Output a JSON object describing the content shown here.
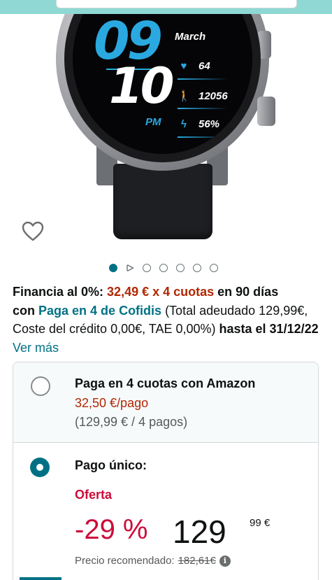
{
  "watch_face": {
    "month": "March",
    "hour": "09",
    "minute": "10",
    "ampm": "PM",
    "heart_rate": "64",
    "steps": "12056",
    "battery": "56%",
    "icons": [
      "heart-icon",
      "walker-icon",
      "bolt-icon"
    ]
  },
  "gallery": {
    "total_dots": 7,
    "active_index": 0
  },
  "finance": {
    "prefix": "Financia al 0%: ",
    "installments": "32,49 € x 4 cuotas",
    "days": " en 90 días",
    "con": "con ",
    "provider": "Paga en 4 de Cofidis",
    "terms": " (Total adeudado 129,99€, Coste del crédito 0,00€, TAE 0,00%)",
    "until": "hasta el 31/12/22",
    "see_more": "Ver más"
  },
  "payment_options": {
    "installments": {
      "title": "Paga en 4 cuotas con Amazon",
      "per_payment": "32,50 €/pago",
      "detail": "(129,99 € / 4 pagos)",
      "selected": false
    },
    "single": {
      "title": "Pago único:",
      "deal_label": "Oferta",
      "discount": "-29 %",
      "price_whole": "129",
      "price_fraction": "99 €",
      "recommended_label": "Precio recomendado:",
      "recommended_price": "182,61€",
      "selected": true
    }
  },
  "colors": {
    "accent_teal": "#007185",
    "price_red": "#b12704",
    "deal_red": "#cc0c39",
    "watch_blue": "#2aa9e0"
  }
}
